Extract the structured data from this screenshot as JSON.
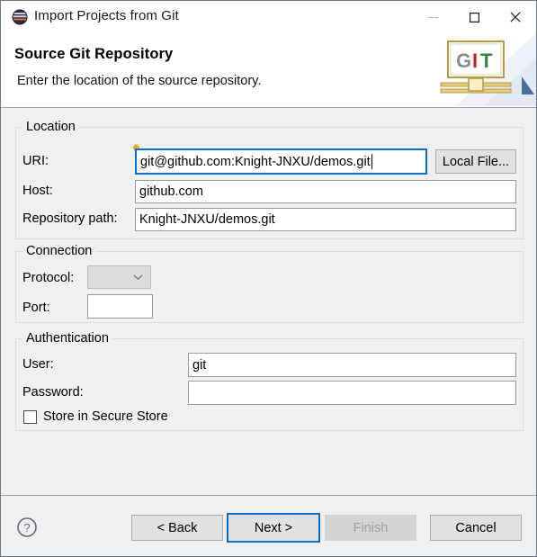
{
  "window": {
    "title": "Import Projects from Git",
    "app_icon": "eclipse-icon",
    "minimize_label": "—",
    "maximize_label": "□",
    "close_label": "✕"
  },
  "header": {
    "title": "Source Git Repository",
    "description": "Enter the location of the source repository.",
    "logo_text": [
      "G",
      "I",
      "T"
    ],
    "logo_colors": {
      "g": "#8c8c8c",
      "i": "#c9211e",
      "t": "#2e8b3d",
      "frame": "#c9a227"
    }
  },
  "groups": {
    "location": {
      "label": "Location",
      "uri": {
        "label": "URI:",
        "value": "git@github.com:Knight-JNXU/demos.git",
        "focused": true,
        "hint_icon": "lightbulb-icon"
      },
      "local_file_button": "Local File...",
      "host": {
        "label": "Host:",
        "value": "github.com"
      },
      "repository_path": {
        "label": "Repository path:",
        "value": "Knight-JNXU/demos.git"
      }
    },
    "connection": {
      "label": "Connection",
      "protocol": {
        "label": "Protocol:",
        "value": "",
        "disabled": true,
        "chevron": "chevron-down-icon"
      },
      "port": {
        "label": "Port:",
        "value": ""
      }
    },
    "authentication": {
      "label": "Authentication",
      "user": {
        "label": "User:",
        "value": "git"
      },
      "password": {
        "label": "Password:",
        "value": ""
      },
      "store_secure": {
        "label": "Store in Secure Store",
        "checked": false
      }
    }
  },
  "buttonbar": {
    "help": "?",
    "back": "< Back",
    "next": "Next >",
    "finish": "Finish",
    "cancel": "Cancel"
  },
  "colors": {
    "accent": "#0a6ed1",
    "dialog_bg": "#f0f0f0",
    "field_bg": "#ffffff",
    "disabled_text": "#a0a0a0"
  }
}
